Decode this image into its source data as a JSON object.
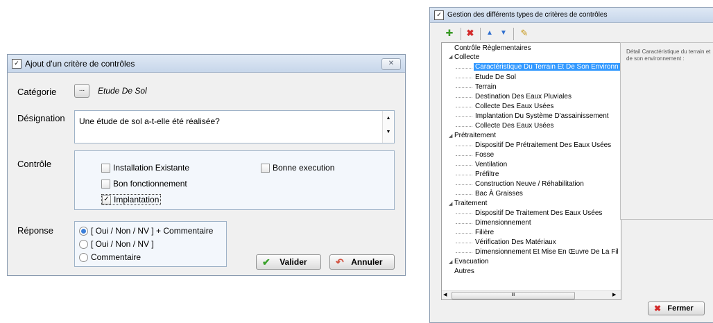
{
  "dialog1": {
    "title": "Ajout d'un critère de contrôles",
    "close_label": "✕",
    "categorie": {
      "label": "Catégorie",
      "button_label": "...",
      "value": "Etude De Sol"
    },
    "designation": {
      "label": "Désignation",
      "value": "Une étude de sol a-t-elle été réalisée?"
    },
    "controle": {
      "label": "Contrôle",
      "options": [
        {
          "label": "Installation Existante",
          "checked": false
        },
        {
          "label": "Bonne execution",
          "checked": false
        },
        {
          "label": "Bon fonctionnement",
          "checked": false
        },
        {
          "label": "Implantation",
          "checked": true
        }
      ]
    },
    "reponse": {
      "label": "Réponse",
      "options": [
        {
          "label": "[ Oui / Non / NV ] + Commentaire",
          "selected": true
        },
        {
          "label": "[ Oui / Non / NV ]",
          "selected": false
        },
        {
          "label": "Commentaire",
          "selected": false
        }
      ]
    },
    "valider_label": "Valider",
    "annuler_label": "Annuler"
  },
  "dialog2": {
    "title": "Gestion des différents types de critères de contrôles",
    "tree": {
      "root": "Contrôle Règlementaires",
      "groups": [
        {
          "label": "Collecte",
          "items": [
            "Caractéristique Du Terrain Et De Son Environn",
            "Etude De Sol",
            "Terrain",
            "Destination Des Eaux Pluviales",
            "Collecte Des Eaux Usées",
            "Implantation Du Système D'assainissement",
            "Collecte Des Eaux Usées"
          ]
        },
        {
          "label": "Prétraitement",
          "items": [
            "Dispositif De Prétraitement Des Eaux Usées",
            "Fosse",
            "Ventilation",
            "Préfiltre",
            "Construction Neuve / Réhabilitation",
            "Bac À Graisses"
          ]
        },
        {
          "label": "Traitement",
          "items": [
            "Dispositif De Traitement Des Eaux Usées",
            "Dimensionnement",
            "Filière",
            "Vérification Des Matériaux",
            "Dimensionnement Et Mise En Œuvre De La Fil"
          ]
        },
        {
          "label": "Evacuation",
          "items": []
        }
      ],
      "last": "Autres",
      "scroll_thumb": "III"
    },
    "detail_text": "Détail Caractéristique du terrain et de son environnement :",
    "fermer_label": "Fermer"
  }
}
